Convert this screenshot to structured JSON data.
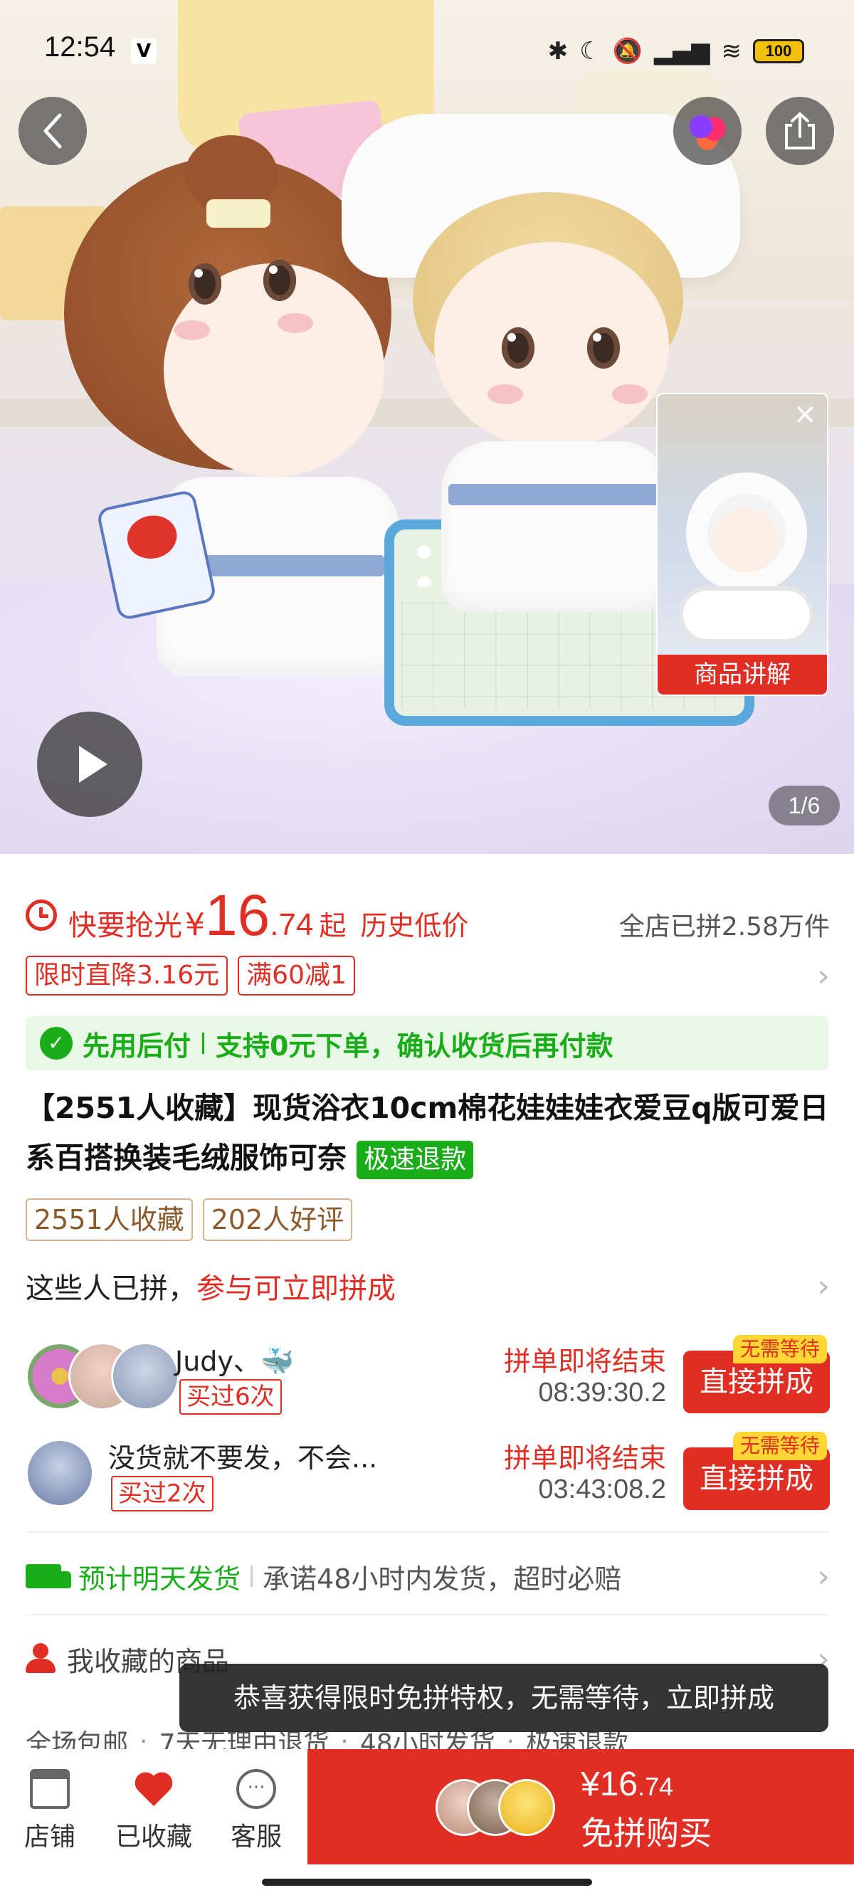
{
  "status_bar": {
    "time": "12:54",
    "app_badge": "V",
    "battery": "100",
    "icons": [
      "bluetooth-icon",
      "moon-icon",
      "mute-icon",
      "signal-icon",
      "wifi-icon"
    ]
  },
  "media": {
    "video_card_label": "商品讲解",
    "pager": "1/6"
  },
  "price": {
    "hurry_label": "快要抢光",
    "currency": "¥",
    "integer": "16",
    "decimal": ".74",
    "suffix": "起",
    "history_low": "历史低价",
    "sold": "全店已拼2.58万件"
  },
  "promos": [
    "限时直降3.16元",
    "满60减1"
  ],
  "pay_later": {
    "title": "先用后付",
    "desc": "支持0元下单，确认收货后再付款"
  },
  "product": {
    "title": "【2551人收藏】现货浴衣10cm棉花娃娃娃衣爱豆q版可爱日系百搭换装毛绒服饰可奈",
    "fast_refund": "极速退款"
  },
  "badges": [
    "2551人收藏",
    "202人好评"
  ],
  "group": {
    "prefix": "这些人已拼，",
    "join": "参与可立即拼成",
    "items": [
      {
        "name": "Judy、🐳",
        "bought": "买过6次",
        "ending": "拼单即将结束",
        "timer": "08:39:30.2",
        "button": "直接拼成",
        "no_wait": "无需等待"
      },
      {
        "name": "没货就不要发，不会...",
        "bought": "买过2次",
        "ending": "拼单即将结束",
        "timer": "03:43:08.2",
        "button": "直接拼成",
        "no_wait": "无需等待"
      }
    ]
  },
  "shipping": {
    "highlight": "预计明天发货",
    "text": "承诺48小时内发货，超时必赔"
  },
  "favorites": {
    "label": "我收藏的商品"
  },
  "services": [
    "全场包邮",
    "7天无理由退货",
    "48小时发货",
    "极速退款"
  ],
  "toast": "恭喜获得限时免拼特权，无需等待，立即拼成",
  "bottom_bar": {
    "store": "店铺",
    "collected": "已收藏",
    "service": "客服",
    "buy_price_int": "¥16",
    "buy_price_dec": ".74",
    "buy_label": "免拼购买"
  },
  "colors": {
    "accent": "#e02e24",
    "green": "#1aad19",
    "badge_brown": "#8b5a2b",
    "no_wait_yellow": "#ffd633"
  }
}
